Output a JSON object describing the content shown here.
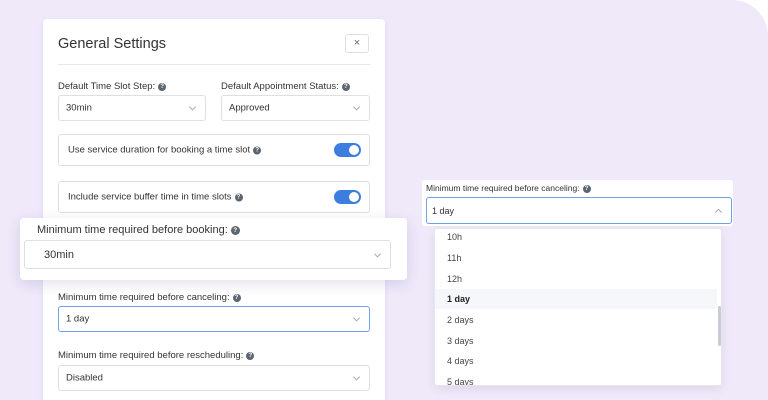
{
  "modal": {
    "title": "General Settings",
    "close_label": "×",
    "time_slot_step": {
      "label": "Default Time Slot Step:",
      "value": "30min"
    },
    "appointment_status": {
      "label": "Default Appointment Status:",
      "value": "Approved"
    },
    "toggle_service_duration": {
      "label": "Use service duration for booking a time slot",
      "enabled": true
    },
    "toggle_buffer_time": {
      "label": "Include service buffer time in time slots",
      "enabled": true
    },
    "min_before_canceling": {
      "label": "Minimum time required before canceling:",
      "value": "1 day"
    },
    "min_before_rescheduling": {
      "label": "Minimum time required before rescheduling:",
      "value": "Disabled"
    }
  },
  "floating_booking": {
    "label": "Minimum time required before booking:",
    "value": "30min"
  },
  "canceling_dropdown": {
    "label": "Minimum time required before canceling:",
    "value": "1 day",
    "options": [
      "10h",
      "11h",
      "12h",
      "1 day",
      "2 days",
      "3 days",
      "4 days",
      "5 days"
    ],
    "selected_index": 3
  },
  "colors": {
    "background": "#efe9fa",
    "accent": "#3e7de0",
    "focus_border": "#6fa0e8"
  },
  "icons": {
    "help": "question-mark-circle-icon",
    "chevron": "chevron-down-icon"
  }
}
